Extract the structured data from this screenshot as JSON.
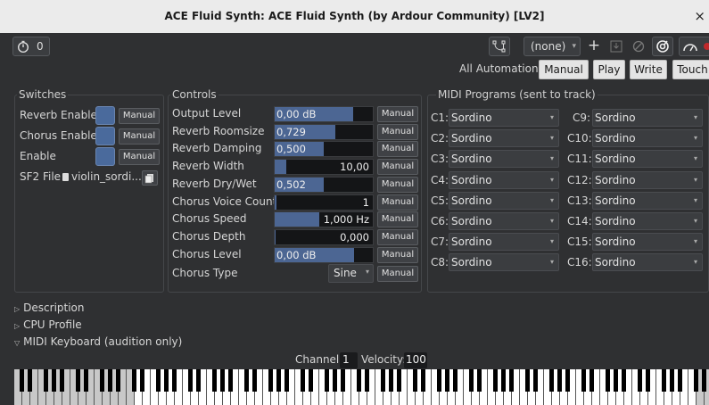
{
  "window": {
    "title": "ACE Fluid Synth: ACE Fluid Synth (by Ardour Community) [LV2]",
    "close_glyph": "×"
  },
  "toolbar": {
    "latency_value": "0",
    "preset": "(none)",
    "preset_arrow": "▾",
    "add_glyph": "+",
    "save_glyph": "⏍",
    "delete_glyph": "⃠",
    "icons": [
      "latency-icon",
      "pin-routing-icon",
      "add-preset-icon",
      "save-preset-icon",
      "delete-preset-icon",
      "plugin-analysis-icon",
      "cpu-profile-icon"
    ]
  },
  "automation": {
    "label": "All Automation",
    "buttons": [
      "Manual",
      "Play",
      "Write",
      "Touch"
    ]
  },
  "switches": {
    "title": "Switches",
    "items": [
      {
        "label": "Reverb Enable",
        "manual": "Manual"
      },
      {
        "label": "Chorus Enable",
        "manual": "Manual"
      },
      {
        "label": "Enable",
        "manual": "Manual"
      }
    ],
    "sf2_label": "SF2 File",
    "sf2_file": "violin_sordi..."
  },
  "controls": {
    "title": "Controls",
    "items": [
      {
        "label": "Output Level",
        "value": "0,00 dB",
        "level": 0.8,
        "align": "left",
        "manual": "Manual"
      },
      {
        "label": "Reverb Roomsize",
        "value": "0,729",
        "level": 0.62,
        "align": "left",
        "manual": "Manual"
      },
      {
        "label": "Reverb Damping",
        "value": "0,500",
        "level": 0.5,
        "align": "left",
        "manual": "Manual"
      },
      {
        "label": "Reverb Width",
        "value": "10,00",
        "level": 0.12,
        "align": "right",
        "manual": "Manual"
      },
      {
        "label": "Reverb Dry/Wet",
        "value": "0,502",
        "level": 0.5,
        "align": "left",
        "manual": "Manual"
      },
      {
        "label": "Chorus Voice Count",
        "value": "1",
        "level": 0.02,
        "align": "right",
        "manual": "Manual"
      },
      {
        "label": "Chorus Speed",
        "value": "1,000 Hz",
        "level": 0.45,
        "align": "right",
        "manual": "Manual"
      },
      {
        "label": "Chorus Depth",
        "value": "0,000",
        "level": 0.01,
        "align": "right",
        "manual": "Manual"
      },
      {
        "label": "Chorus Level",
        "value": "0,00 dB",
        "level": 0.81,
        "align": "left",
        "manual": "Manual"
      }
    ],
    "chorus_type_label": "Chorus Type",
    "chorus_type_value": "Sine",
    "chorus_type_manual": "Manual"
  },
  "midi_programs": {
    "title": "MIDI Programs (sent to track)",
    "left": [
      {
        "label": "C1:",
        "value": "Sordino"
      },
      {
        "label": "C2:",
        "value": "Sordino"
      },
      {
        "label": "C3:",
        "value": "Sordino"
      },
      {
        "label": "C4:",
        "value": "Sordino"
      },
      {
        "label": "C5:",
        "value": "Sordino"
      },
      {
        "label": "C6:",
        "value": "Sordino"
      },
      {
        "label": "C7:",
        "value": "Sordino"
      },
      {
        "label": "C8:",
        "value": "Sordino"
      }
    ],
    "right": [
      {
        "label": "C9:",
        "value": "Sordino"
      },
      {
        "label": "C10:",
        "value": "Sordino"
      },
      {
        "label": "C11:",
        "value": "Sordino"
      },
      {
        "label": "C12:",
        "value": "Sordino"
      },
      {
        "label": "C13:",
        "value": "Sordino"
      },
      {
        "label": "C14:",
        "value": "Sordino"
      },
      {
        "label": "C15:",
        "value": "Sordino"
      },
      {
        "label": "C16:",
        "value": "Sordino"
      }
    ]
  },
  "expanders": [
    {
      "label": "Description",
      "open": false
    },
    {
      "label": "CPU Profile",
      "open": false
    },
    {
      "label": "MIDI Keyboard (audition only)",
      "open": true
    }
  ],
  "keyboard": {
    "channel_label": "Channel:",
    "channel": "1",
    "velocity_label": "Velocity:",
    "velocity": "100",
    "highlight_range": [
      15,
      84
    ]
  }
}
